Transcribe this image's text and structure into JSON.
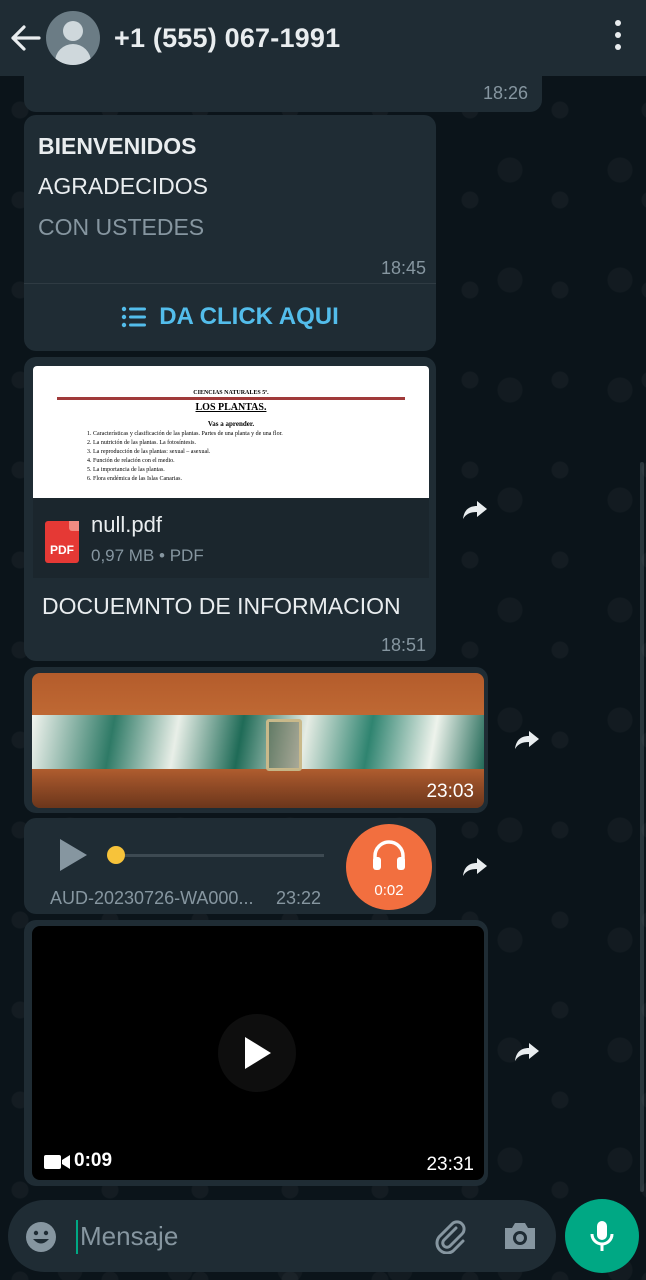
{
  "header": {
    "contact_name": "+1 (555) 067-1991"
  },
  "messages": {
    "prev_time": "18:26",
    "welcome": {
      "line1": "BIENVENIDOS",
      "line2": "AGRADECIDOS",
      "line3": "CON USTEDES",
      "time": "18:45",
      "button_label": "DA CLICK AQUI"
    },
    "document": {
      "preview": {
        "header": "CIENCIAS NATURALES 5º.",
        "title": "LOS PLANTAS.",
        "subtitle": "Vas a aprender.",
        "items": [
          "Características y clasificación de las plantas. Partes de una planta y de una flor.",
          "La nutrición de las plantas. La fotosíntesis.",
          "La reproducción de las plantas: sexual – asexual.",
          "Función de relación con el medio.",
          "La importancia de las plantas.",
          "Flora endémica de las Islas Canarias."
        ]
      },
      "file_icon_label": "PDF",
      "file_name": "null.pdf",
      "file_meta": "0,97 MB • PDF",
      "caption": "DOCUEMNTO DE INFORMACION",
      "time": "18:51"
    },
    "photo": {
      "time": "23:03"
    },
    "audio": {
      "file_name": "AUD-20230726-WA000...",
      "time": "23:22",
      "duration": "0:02",
      "progress": 0
    },
    "video": {
      "duration": "0:09",
      "time": "23:31"
    }
  },
  "input": {
    "placeholder": "Mensaje"
  },
  "colors": {
    "header_bg": "#1f2c34",
    "bubble_bg": "#1f2c34",
    "link": "#53bdeb",
    "accent": "#00a884",
    "audio_avatar": "#f26f3f"
  },
  "icons": [
    "back-arrow-icon",
    "avatar-placeholder-icon",
    "more-vert-icon",
    "list-icon",
    "pdf-icon",
    "forward-icon",
    "play-icon",
    "headphones-icon",
    "video-camera-icon",
    "emoji-icon",
    "attach-icon",
    "camera-icon",
    "mic-icon"
  ]
}
